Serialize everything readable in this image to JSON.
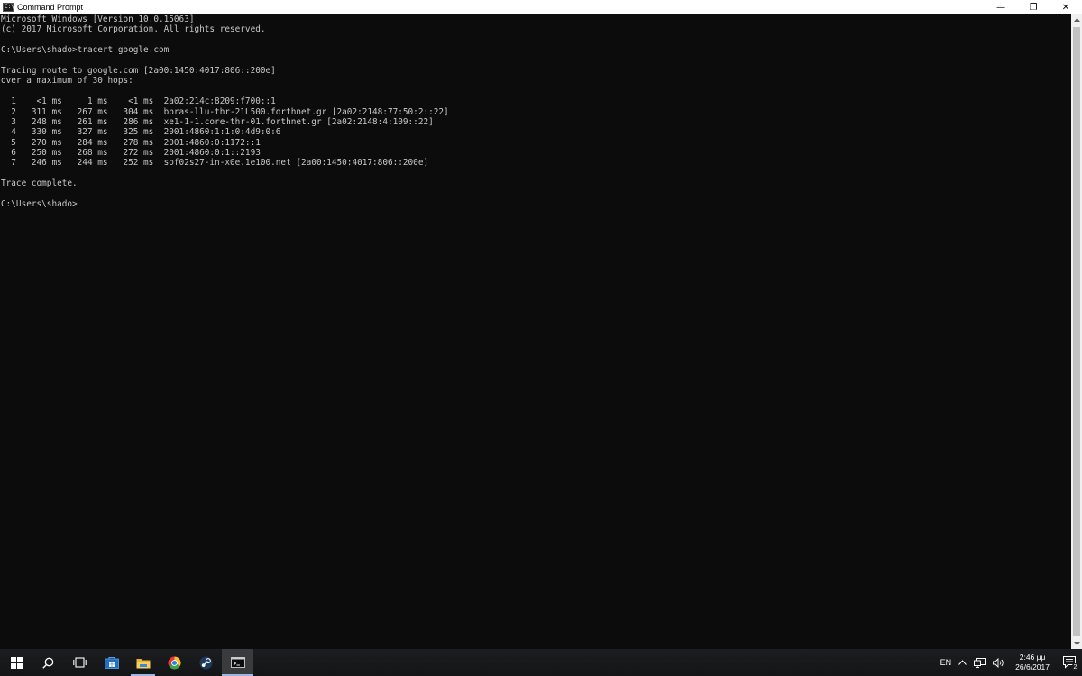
{
  "window": {
    "title": "Command Prompt",
    "icon_label": "C:\\",
    "controls": {
      "minimize": "—",
      "restore": "❐",
      "close": "✕"
    }
  },
  "console": {
    "lines": [
      "Microsoft Windows [Version 10.0.15063]",
      "(c) 2017 Microsoft Corporation. All rights reserved.",
      "",
      "C:\\Users\\shado>tracert google.com",
      "",
      "Tracing route to google.com [2a00:1450:4017:806::200e]",
      "over a maximum of 30 hops:",
      "",
      "  1    <1 ms     1 ms    <1 ms  2a02:214c:8209:f700::1",
      "  2   311 ms   267 ms   304 ms  bbras-llu-thr-21L500.forthnet.gr [2a02:2148:77:50:2::22]",
      "  3   248 ms   261 ms   286 ms  xe1-1-1.core-thr-01.forthnet.gr [2a02:2148:4:109::22]",
      "  4   330 ms   327 ms   325 ms  2001:4860:1:1:0:4d9:0:6",
      "  5   270 ms   284 ms   278 ms  2001:4860:0:1172::1",
      "  6   250 ms   268 ms   272 ms  2001:4860:0:1::2193",
      "  7   246 ms   244 ms   252 ms  sof02s27-in-x0e.1e100.net [2a00:1450:4017:806::200e]",
      "",
      "Trace complete.",
      "",
      "C:\\Users\\shado>"
    ]
  },
  "taskbar": {
    "apps": [
      {
        "id": "start",
        "icon": "windows-icon"
      },
      {
        "id": "search",
        "icon": "search-icon"
      },
      {
        "id": "task-view",
        "icon": "task-view-icon"
      },
      {
        "id": "store",
        "icon": "store-icon"
      },
      {
        "id": "file-explorer",
        "icon": "folder-icon"
      },
      {
        "id": "chrome",
        "icon": "chrome-icon"
      },
      {
        "id": "steam",
        "icon": "steam-icon"
      },
      {
        "id": "cmd",
        "icon": "cmd-icon"
      }
    ],
    "tray": {
      "language": "EN",
      "time": "2:46 μμ",
      "date": "26/6/2017",
      "notification_count": "2"
    }
  },
  "colors": {
    "console_bg": "#0c0c0c",
    "console_text": "#c8c8c8",
    "taskbar_bg": "#1a1b1d",
    "accent": "#9ab8e0"
  }
}
